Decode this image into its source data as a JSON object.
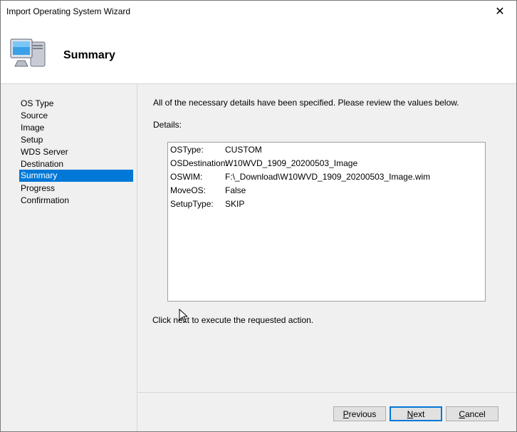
{
  "window": {
    "title": "Import Operating System Wizard",
    "close_glyph": "✕"
  },
  "header": {
    "title": "Summary",
    "icon": "computer-icon"
  },
  "nav": {
    "items": [
      {
        "label": "OS Type"
      },
      {
        "label": "Source"
      },
      {
        "label": "Image"
      },
      {
        "label": "Setup"
      },
      {
        "label": "WDS Server"
      },
      {
        "label": "Destination"
      },
      {
        "label": "Summary",
        "active": true
      },
      {
        "label": "Progress"
      },
      {
        "label": "Confirmation"
      }
    ]
  },
  "content": {
    "intro": "All of the necessary details have been specified.  Please review the values below.",
    "details_label": "Details:",
    "details": [
      {
        "key": "OSType:",
        "value": "CUSTOM"
      },
      {
        "key": "OSDestination:",
        "value": "W10WVD_1909_20200503_Image"
      },
      {
        "key": "OSWIM:",
        "value": "F:\\_Download\\W10WVD_1909_20200503_Image.wim"
      },
      {
        "key": "MoveOS:",
        "value": "False"
      },
      {
        "key": "SetupType:",
        "value": "SKIP"
      }
    ],
    "footer": "Click next to execute the requested action."
  },
  "buttons": {
    "previous": {
      "pre": "",
      "accel": "P",
      "post": "revious"
    },
    "next": {
      "pre": "",
      "accel": "N",
      "post": "ext"
    },
    "cancel": {
      "pre": "",
      "accel": "C",
      "post": "ancel"
    }
  },
  "colors": {
    "accent": "#0078d7",
    "panel": "#f0f0f0",
    "button": "#e1e1e1"
  }
}
